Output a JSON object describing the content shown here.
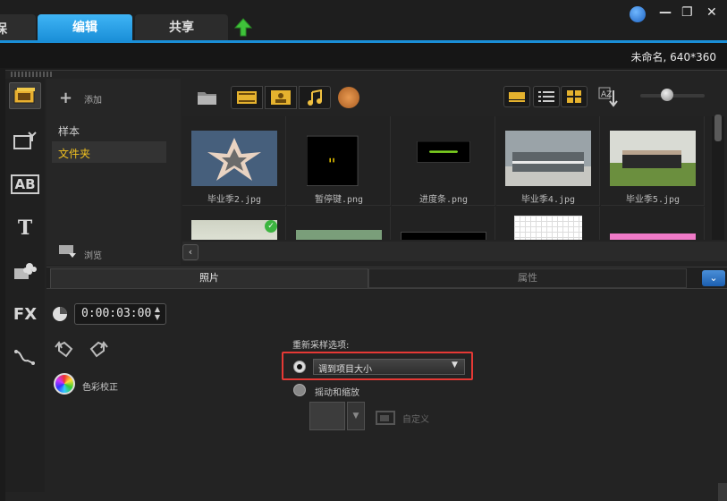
{
  "tabs": {
    "prev_stub": "保",
    "edit": "编辑",
    "share": "共享"
  },
  "window_controls": {
    "minimize": "—",
    "maximize": "❐",
    "close": "✕"
  },
  "project_info": "未命名, 640*360",
  "library": {
    "add_label": "添加",
    "folders": [
      "样本",
      "文件夹"
    ],
    "browse_label": "浏览",
    "items": [
      {
        "name": "毕业季2.jpg"
      },
      {
        "name": "暂停键.png"
      },
      {
        "name": "进度条.png"
      },
      {
        "name": "毕业季4.jpg"
      },
      {
        "name": "毕业季5.jpg"
      }
    ]
  },
  "options": {
    "tab_photo": "照片",
    "tab_attributes": "属性",
    "duration": "0:00:03:00",
    "color_correction": "色彩校正",
    "resample_title": "重新采样选项:",
    "resample_selected": "调到项目大小",
    "pan_zoom": "摇动和缩放",
    "customize": "自定义"
  },
  "left_tools": {
    "title_tool": "AB",
    "text_tool": "T",
    "fx_tool": "FX"
  },
  "colors": {
    "accent": "#1a8fd8",
    "active_folder": "#f0c020",
    "highlight": "#e53935"
  }
}
